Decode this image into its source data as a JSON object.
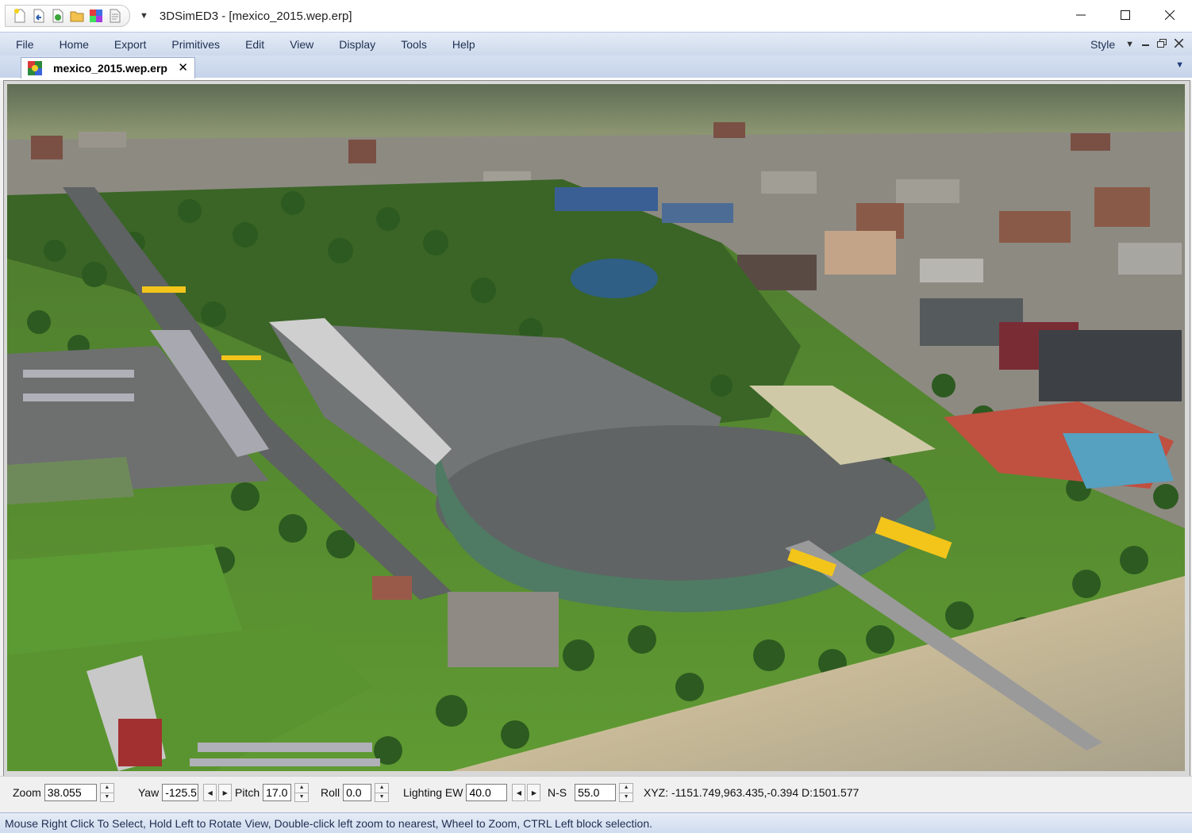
{
  "window": {
    "title": "3DSimED3 - [mexico_2015.wep.erp]",
    "controls": [
      "minimize",
      "maximize",
      "close"
    ]
  },
  "quick_access": {
    "icons": [
      "new-file-icon",
      "undo-icon",
      "redo-icon",
      "open-folder-icon",
      "color-palette-icon",
      "document-icon"
    ],
    "dropdown_glyph": "▼"
  },
  "menu": {
    "items": [
      "File",
      "Home",
      "Export",
      "Primitives",
      "Edit",
      "View",
      "Display",
      "Tools",
      "Help"
    ],
    "style_label": "Style",
    "style_dropdown": "▼"
  },
  "document_tab": {
    "label": "mexico_2015.wep.erp",
    "close_glyph": "✕",
    "overflow_glyph": "▼"
  },
  "controls": {
    "zoom": {
      "label": "Zoom",
      "value": "38.055"
    },
    "yaw": {
      "label": "Yaw",
      "value": "-125.5"
    },
    "pitch": {
      "label": "Pitch",
      "value": "17.0"
    },
    "roll": {
      "label": "Roll",
      "value": "0.0"
    },
    "lighting_ew": {
      "label": "Lighting EW",
      "value": "40.0"
    },
    "ns": {
      "label": "N-S",
      "value": "55.0"
    },
    "xyz_readout": "XYZ: -1151.749,963.435,-0.394  D:1501.577"
  },
  "status": {
    "text": "Mouse Right Click To Select, Hold Left to Rotate View, Double-click left  zoom to nearest, Wheel to Zoom, CTRL Left block selection."
  },
  "scene": {
    "description_icons": [
      "race-track",
      "grandstand",
      "stadium",
      "city-buildings",
      "trees"
    ],
    "colors": {
      "sky": "#7c8a6a",
      "grass": "#4f8a2c",
      "asphalt": "#6e7070",
      "tree": "#2f5a22",
      "building": "#8f8a84",
      "stand_green": "#5a7f6a",
      "banner": "#f3c51a"
    }
  }
}
